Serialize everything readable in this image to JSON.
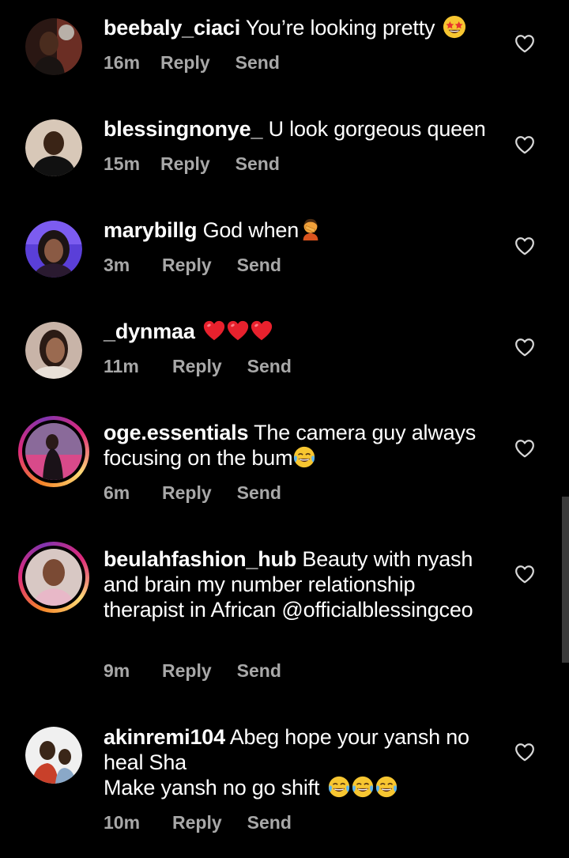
{
  "comments": [
    {
      "username": "beebaly_ciaci",
      "text": "You’re looking pretty",
      "emoji": [
        "star-struck"
      ],
      "time": "16m",
      "reply": "Reply",
      "send": "Send"
    },
    {
      "username": "blessingnonye_",
      "text": "U look gorgeous queen",
      "emoji": [],
      "time": "15m",
      "reply": "Reply",
      "send": "Send"
    },
    {
      "username": "marybillg",
      "text": "God when",
      "emoji": [
        "person-facepalming"
      ],
      "time": "3m",
      "reply": "Reply",
      "send": "Send"
    },
    {
      "username": "_dynmaa",
      "text": "",
      "emoji": [
        "red-heart",
        "red-heart",
        "red-heart"
      ],
      "time": "11m",
      "reply": "Reply",
      "send": "Send"
    },
    {
      "username": "oge.essentials",
      "text": "The camera guy always focusing on the bum",
      "emoji": [
        "tears-of-joy"
      ],
      "time": "6m",
      "reply": "Reply",
      "send": "Send",
      "story_ring": true
    },
    {
      "username": "beulahfashion_hub",
      "text": "Beauty with nyash and brain my number relationship therapist in African @officialblessingceo",
      "emoji": [],
      "time": "9m",
      "reply": "Reply",
      "send": "Send",
      "story_ring": true
    },
    {
      "username": "akinremi104",
      "text": "Abeg hope your yansh no heal Sha",
      "text2": "Make yansh no go shift",
      "emoji": [
        "tears-of-joy",
        "tears-of-joy",
        "tears-of-joy"
      ],
      "time": "10m",
      "reply": "Reply",
      "send": "Send"
    }
  ],
  "colors": {
    "background": "#000000",
    "text": "#ffffff",
    "meta": "#a8a8a8",
    "story_ring_start": "#f58529",
    "story_ring_end": "#dd2a7b"
  }
}
